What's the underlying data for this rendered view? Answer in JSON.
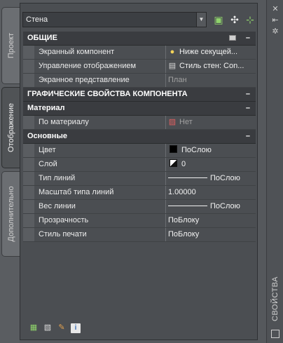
{
  "palette": {
    "title": "СВОЙСТВА",
    "tabs": [
      {
        "label": "Проект",
        "active": false
      },
      {
        "label": "Отображение",
        "active": true
      },
      {
        "label": "Дополнительно",
        "active": false
      }
    ],
    "selector": {
      "value": "Стена"
    },
    "tool_icons": [
      "add-selection-icon",
      "quick-select-icon",
      "select-objects-icon"
    ],
    "strip_icons": [
      "auto-hide-icon",
      "close-icon",
      "settings-icon"
    ]
  },
  "sections": {
    "general": {
      "title": "ОБЩИЕ",
      "rows": [
        {
          "name": "Экранный компонент",
          "value": "Ниже секущей...",
          "icon": "lightbulb-icon"
        },
        {
          "name": "Управление отображением",
          "value": "Стиль стен: Con...",
          "icon": "display-control-icon"
        },
        {
          "name": "Экранное представление",
          "value": "План"
        }
      ]
    },
    "graphic": {
      "title": "ГРАФИЧЕСКИЕ СВОЙСТВА КОМПОНЕНТА"
    },
    "material": {
      "title": "Материал",
      "rows": [
        {
          "name": "По материалу",
          "value": "Нет",
          "icon": "by-material-icon"
        }
      ]
    },
    "basic": {
      "title": "Основные",
      "rows": [
        {
          "name": "Цвет",
          "value": "ПоСлою",
          "swatch_color": "#000000"
        },
        {
          "name": "Слой",
          "value": "0"
        },
        {
          "name": "Тип линий",
          "value": "ПоСлою"
        },
        {
          "name": "Масштаб типа линий",
          "value": "1.00000"
        },
        {
          "name": "Вес линии",
          "value": "ПоСлою"
        },
        {
          "name": "Прозрачность",
          "value": "ПоБлоку"
        },
        {
          "name": "Стиль печати",
          "value": "ПоБлоку"
        }
      ]
    }
  },
  "bottom_icons": [
    "edit-style-icon",
    "style-properties-icon",
    "match-properties-icon",
    "info-icon"
  ],
  "collapse_symbol": "–"
}
